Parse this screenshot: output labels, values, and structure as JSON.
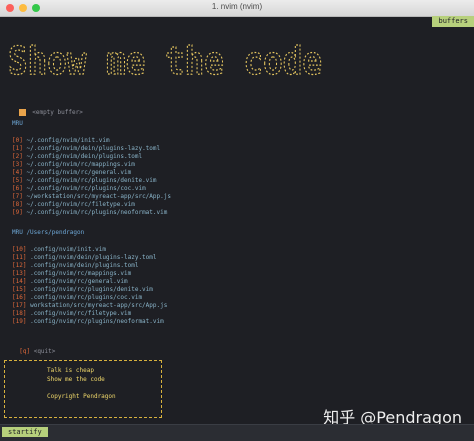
{
  "window": {
    "title": "1. nvim (nvim)"
  },
  "tabline": {
    "buffers_label": "buffers"
  },
  "banner": {
    "text": "Show me the code"
  },
  "empty_buffer": "<empty buffer>",
  "mru": {
    "header": "MRU",
    "items": [
      {
        "index": "[0]",
        "path": "~/.config/nvim/init.vim"
      },
      {
        "index": "[1]",
        "path": "~/.config/nvim/dein/plugins-lazy.toml"
      },
      {
        "index": "[2]",
        "path": "~/.config/nvim/dein/plugins.toml"
      },
      {
        "index": "[3]",
        "path": "~/.config/nvim/rc/mappings.vim"
      },
      {
        "index": "[4]",
        "path": "~/.config/nvim/rc/general.vim"
      },
      {
        "index": "[5]",
        "path": "~/.config/nvim/rc/plugins/denite.vim"
      },
      {
        "index": "[6]",
        "path": "~/.config/nvim/rc/plugins/coc.vim"
      },
      {
        "index": "[7]",
        "path": "~/workstation/src/myreact-app/src/App.js"
      },
      {
        "index": "[8]",
        "path": "~/.config/nvim/rc/filetype.vim"
      },
      {
        "index": "[9]",
        "path": "~/.config/nvim/rc/plugins/neoformat.vim"
      }
    ]
  },
  "mru_dir": {
    "header": "MRU /Users/pendragon",
    "items": [
      {
        "index": "[10]",
        "path": ".config/nvim/init.vim"
      },
      {
        "index": "[11]",
        "path": ".config/nvim/dein/plugins-lazy.toml"
      },
      {
        "index": "[12]",
        "path": ".config/nvim/dein/plugins.toml"
      },
      {
        "index": "[13]",
        "path": ".config/nvim/rc/mappings.vim"
      },
      {
        "index": "[14]",
        "path": ".config/nvim/rc/general.vim"
      },
      {
        "index": "[15]",
        "path": ".config/nvim/rc/plugins/denite.vim"
      },
      {
        "index": "[16]",
        "path": ".config/nvim/rc/plugins/coc.vim"
      },
      {
        "index": "[17]",
        "path": "workstation/src/myreact-app/src/App.js"
      },
      {
        "index": "[18]",
        "path": ".config/nvim/rc/filetype.vim"
      },
      {
        "index": "[19]",
        "path": ".config/nvim/rc/plugins/neoformat.vim"
      }
    ]
  },
  "quit": {
    "index": "[q]",
    "label": "<quit>"
  },
  "footer_box": {
    "line1": "Talk is cheap",
    "line2": "Show me the code",
    "line3": "Copyright Pendragon"
  },
  "watermark": "知乎 @Pendragon",
  "statusline": {
    "mode": "startify"
  },
  "colors": {
    "accent_green": "#b7d07c",
    "index_orange": "#e0693a",
    "path_blue": "#8ab4c9",
    "banner_yellow": "#e8c860"
  }
}
